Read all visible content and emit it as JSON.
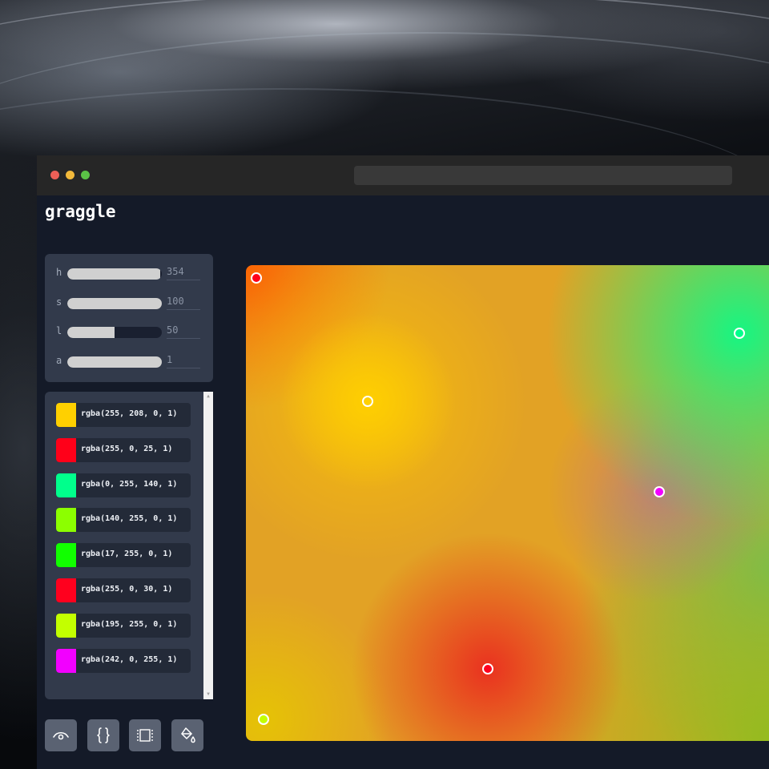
{
  "app": {
    "logo": "graggle"
  },
  "window": {
    "traffic_lights": [
      "#ee5f57",
      "#f2b93b",
      "#5bc246"
    ],
    "url_bar": ""
  },
  "sliders": [
    {
      "label": "h",
      "value": "354",
      "fill_fraction": 0.985
    },
    {
      "label": "s",
      "value": "100",
      "fill_fraction": 1.0
    },
    {
      "label": "l",
      "value": "50",
      "fill_fraction": 0.5
    },
    {
      "label": "a",
      "value": "1",
      "fill_fraction": 1.0
    }
  ],
  "colors": [
    {
      "label": "rgba(255, 208, 0, 1)",
      "swatch": "#ffd000"
    },
    {
      "label": "rgba(255, 0, 25, 1)",
      "swatch": "#ff0019"
    },
    {
      "label": "rgba(0, 255, 140, 1)",
      "swatch": "#00ff8c"
    },
    {
      "label": "rgba(140, 255, 0, 1)",
      "swatch": "#8cff00"
    },
    {
      "label": "rgba(17, 255, 0, 1)",
      "swatch": "#11ff00"
    },
    {
      "label": "rgba(255, 0, 30, 1)",
      "swatch": "#ff001e"
    },
    {
      "label": "rgba(195, 255, 0, 1)",
      "swatch": "#c3ff00"
    },
    {
      "label": "rgba(242, 0, 255, 1)",
      "swatch": "#f200ff"
    }
  ],
  "toolbar": [
    {
      "icon": "eye-icon"
    },
    {
      "icon": "code-braces-icon"
    },
    {
      "icon": "frame-icon"
    },
    {
      "icon": "paint-bucket-icon"
    }
  ],
  "canvas": {
    "handles": [
      {
        "color": "#ff0019"
      },
      {
        "color": "#00ff8c"
      },
      {
        "color": "#ffd000"
      },
      {
        "color": "#f200ff"
      },
      {
        "color": "#ff001e"
      },
      {
        "color": "#c3ff00"
      }
    ]
  }
}
